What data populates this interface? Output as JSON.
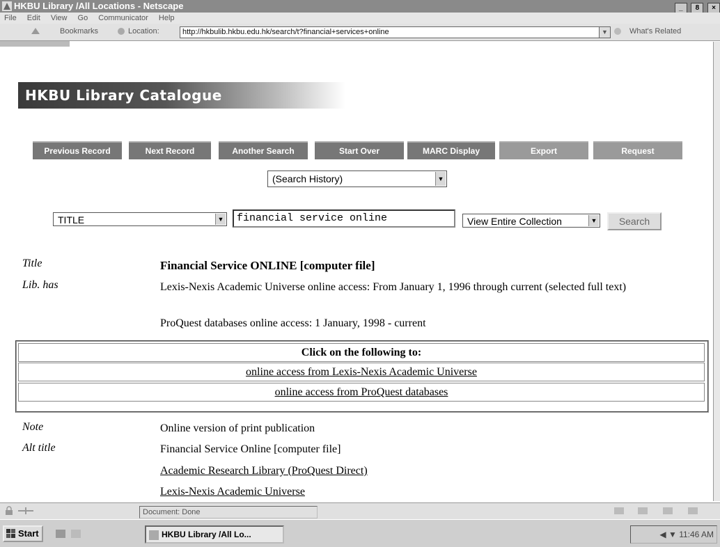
{
  "window": {
    "title": "HKBU Library /All Locations - Netscape",
    "btn_min": "_",
    "btn_max": "8",
    "btn_close": "×"
  },
  "menu": [
    "File",
    "Edit",
    "View",
    "Go",
    "Communicator",
    "Help"
  ],
  "location_bar": {
    "bookmarks": "Bookmarks",
    "location_label": "Location:",
    "url": "http://hkbulib.hkbu.edu.hk/search/t?financial+services+online",
    "whats_related": "What's Related"
  },
  "page": {
    "banner": "HKBU Library Catalogue",
    "nav_buttons": [
      "Previous Record",
      "Next Record",
      "Another Search",
      "Start Over",
      "MARC Display",
      "Export",
      "Request"
    ],
    "search_history": "(Search History)",
    "search_field": "TITLE",
    "search_query": "financial service online",
    "collection": "View Entire Collection",
    "search_button": "Search"
  },
  "record": {
    "title_label": "Title",
    "title_value": "Financial Service ONLINE [computer file]",
    "libhas_label": "Lib. has",
    "libhas_1": "Lexis-Nexis Academic Universe online access: From January 1, 1996 through current (selected full text)",
    "libhas_2": "ProQuest databases online access: 1 January, 1998 - current",
    "box_header": "Click on the following to:",
    "box_link_1": "online access from Lexis-Nexis Academic Universe",
    "box_link_2": "online access from ProQuest databases",
    "note_label": "Note",
    "note_value": "Online version of print publication",
    "alt_label": "Alt title",
    "alt_value": "Financial Service Online [computer file]",
    "link_1": "Academic Research Library (ProQuest Direct)",
    "link_2": "Lexis-Nexis Academic Universe"
  },
  "status": "Document: Done",
  "taskbar": {
    "start": "Start",
    "item": "HKBU Library /All Lo...",
    "clock": "11:46 AM"
  }
}
